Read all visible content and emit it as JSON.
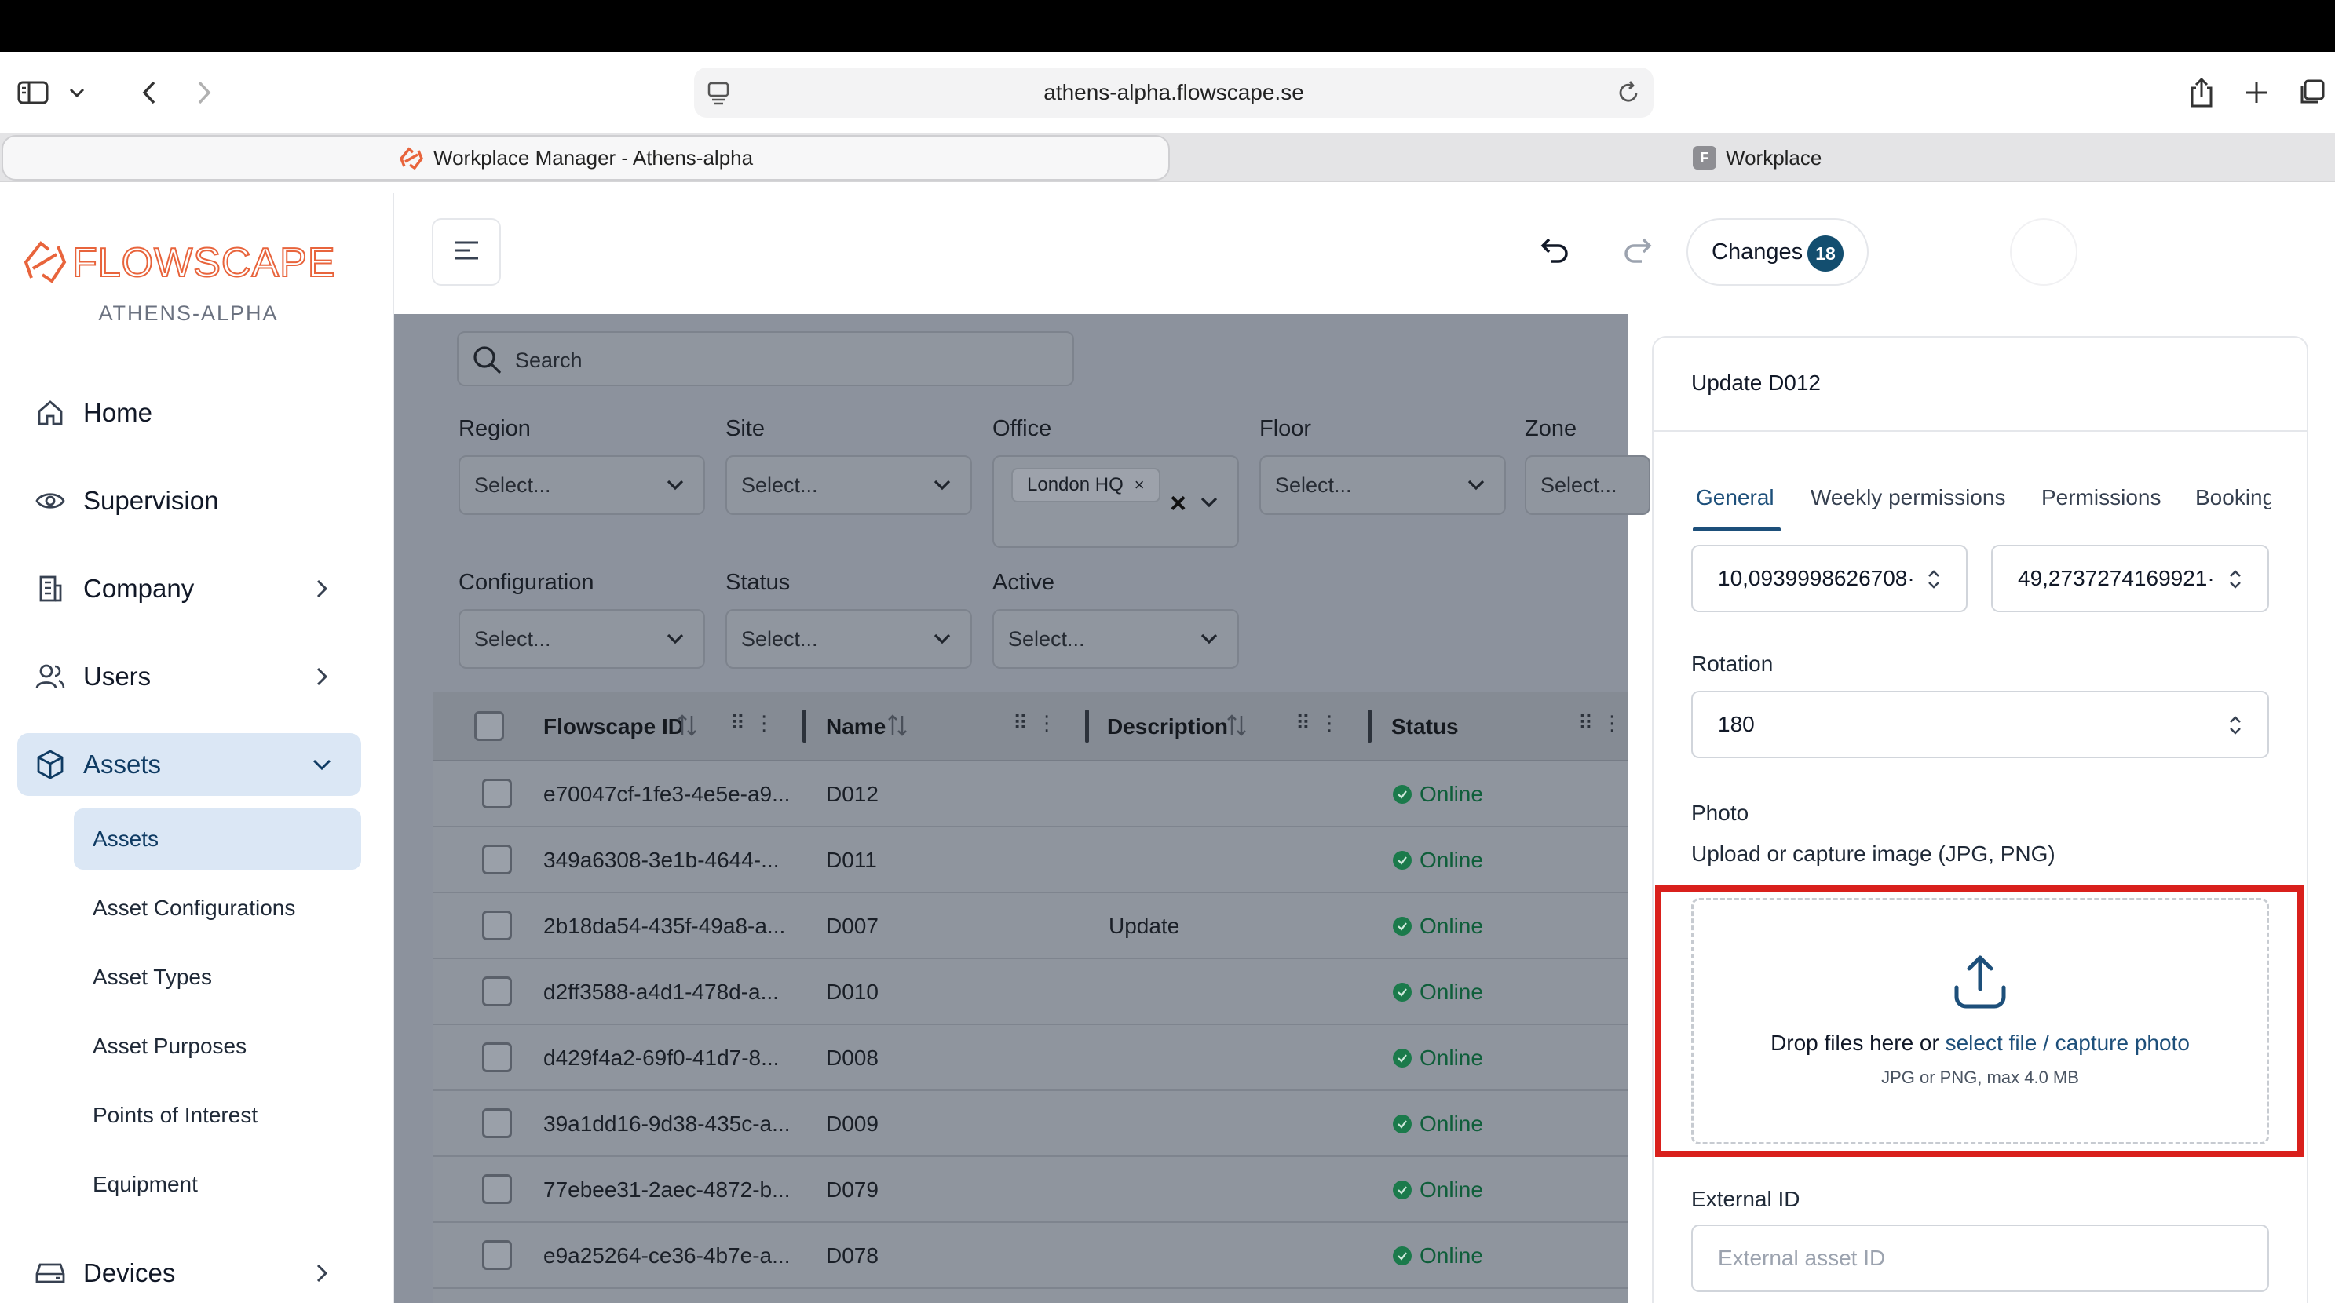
{
  "browser": {
    "url": "athens-alpha.flowscape.se",
    "tabs": [
      {
        "label": "Workplace Manager - Athens-alpha",
        "active": true
      },
      {
        "label": "Workplace",
        "active": false,
        "favicon_letter": "F"
      }
    ]
  },
  "brand": {
    "logo_text": "FLOWSCAPE",
    "tenant": "ATHENS-ALPHA",
    "color": "#e8643c"
  },
  "sidebar": {
    "items": [
      {
        "label": "Home",
        "icon": "home-icon"
      },
      {
        "label": "Supervision",
        "icon": "eye-icon"
      },
      {
        "label": "Company",
        "icon": "building-icon"
      },
      {
        "label": "Users",
        "icon": "users-icon"
      },
      {
        "label": "Assets",
        "icon": "cube-icon"
      },
      {
        "label": "Devices",
        "icon": "device-icon"
      }
    ],
    "asset_sub_items": [
      "Assets",
      "Asset Configurations",
      "Asset Types",
      "Asset Purposes",
      "Points of Interest",
      "Equipment"
    ]
  },
  "header": {
    "changes_label": "Changes",
    "changes_count": "18"
  },
  "filters": {
    "search_placeholder": "Search",
    "region_label": "Region",
    "site_label": "Site",
    "office_label": "Office",
    "floor_label": "Floor",
    "zone_label": "Zone",
    "configuration_label": "Configuration",
    "status_label": "Status",
    "active_label": "Active",
    "select_placeholder": "Select...",
    "office_chip": "London HQ"
  },
  "table": {
    "columns": [
      "Flowscape ID",
      "Name",
      "Description",
      "Status"
    ],
    "rows": [
      {
        "id": "e70047cf-1fe3-4e5e-a9...",
        "name": "D012",
        "description": "",
        "status": "Online"
      },
      {
        "id": "349a6308-3e1b-4644-...",
        "name": "D011",
        "description": "",
        "status": "Online"
      },
      {
        "id": "2b18da54-435f-49a8-a...",
        "name": "D007",
        "description": "Update",
        "status": "Online"
      },
      {
        "id": "d2ff3588-a4d1-478d-a...",
        "name": "D010",
        "description": "",
        "status": "Online"
      },
      {
        "id": "d429f4a2-69f0-41d7-8...",
        "name": "D008",
        "description": "",
        "status": "Online"
      },
      {
        "id": "39a1dd16-9d38-435c-a...",
        "name": "D009",
        "description": "",
        "status": "Online"
      },
      {
        "id": "77ebee31-2aec-4872-b...",
        "name": "D079",
        "description": "",
        "status": "Online"
      },
      {
        "id": "e9a25264-ce36-4b7e-a...",
        "name": "D078",
        "description": "",
        "status": "Online"
      }
    ]
  },
  "panel": {
    "title": "Update D012",
    "tabs": [
      "General",
      "Weekly permissions",
      "Permissions",
      "Booking"
    ],
    "coord_x": "10,0939998626708·",
    "coord_y": "49,2737274169921·",
    "rotation_label": "Rotation",
    "rotation_value": "180",
    "photo_label": "Photo",
    "photo_hint": "Upload or capture image (JPG, PNG)",
    "drop_text": "Drop files here or",
    "select_file": "select file",
    "slash": "/",
    "capture_photo": "capture photo",
    "drop_sub": "JPG or PNG, max 4.0 MB",
    "external_id_label": "External ID",
    "external_id_placeholder": "External asset ID"
  },
  "colors": {
    "accent": "#1d4f7a",
    "highlight": "#d9201c",
    "online": "#1b7a4b"
  }
}
